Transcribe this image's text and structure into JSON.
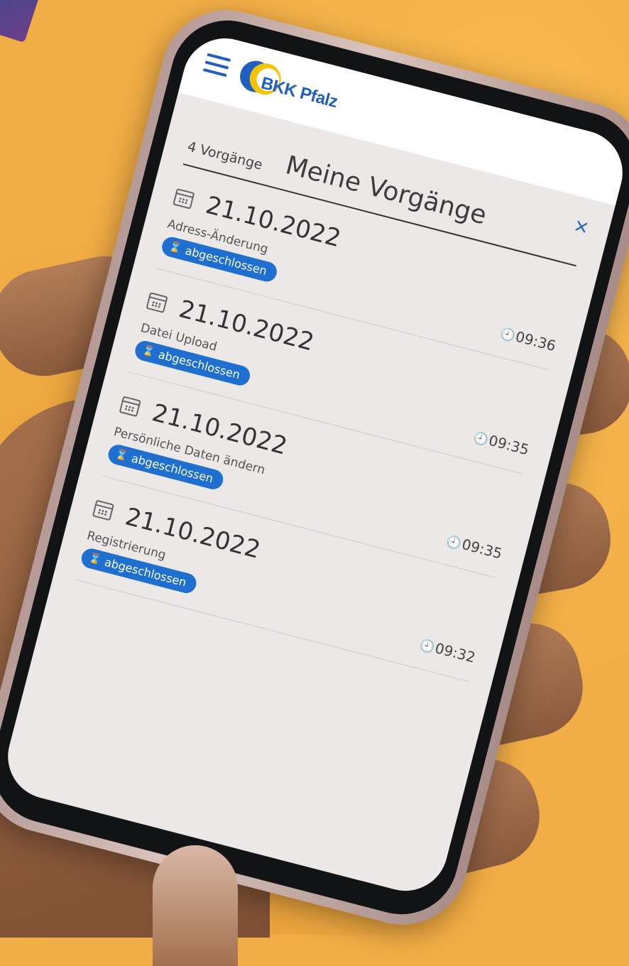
{
  "app": {
    "logo_text": "BKK Pfalz",
    "menu_icon": "hamburger-icon",
    "close_icon": "close-icon",
    "close_symbol": "×",
    "accent_color": "#1f6fd0",
    "logo_yellow": "#f5c400"
  },
  "page": {
    "title": "Meine Vorgänge",
    "count": "4 Vorgänge"
  },
  "entries": [
    {
      "date": "21.10.2022",
      "label": "Adress-Änderung",
      "status": "abgeschlossen",
      "time": "09:36"
    },
    {
      "date": "21.10.2022",
      "label": "Datei Upload",
      "status": "abgeschlossen",
      "time": "09:35"
    },
    {
      "date": "21.10.2022",
      "label": "Persönliche Daten ändern",
      "status": "abgeschlossen",
      "time": "09:35"
    },
    {
      "date": "21.10.2022",
      "label": "Registrierung",
      "status": "abgeschlossen",
      "time": "09:32"
    }
  ],
  "icons": {
    "calendar": "calendar-icon",
    "hourglass": "⌛",
    "clock": "🕘"
  }
}
